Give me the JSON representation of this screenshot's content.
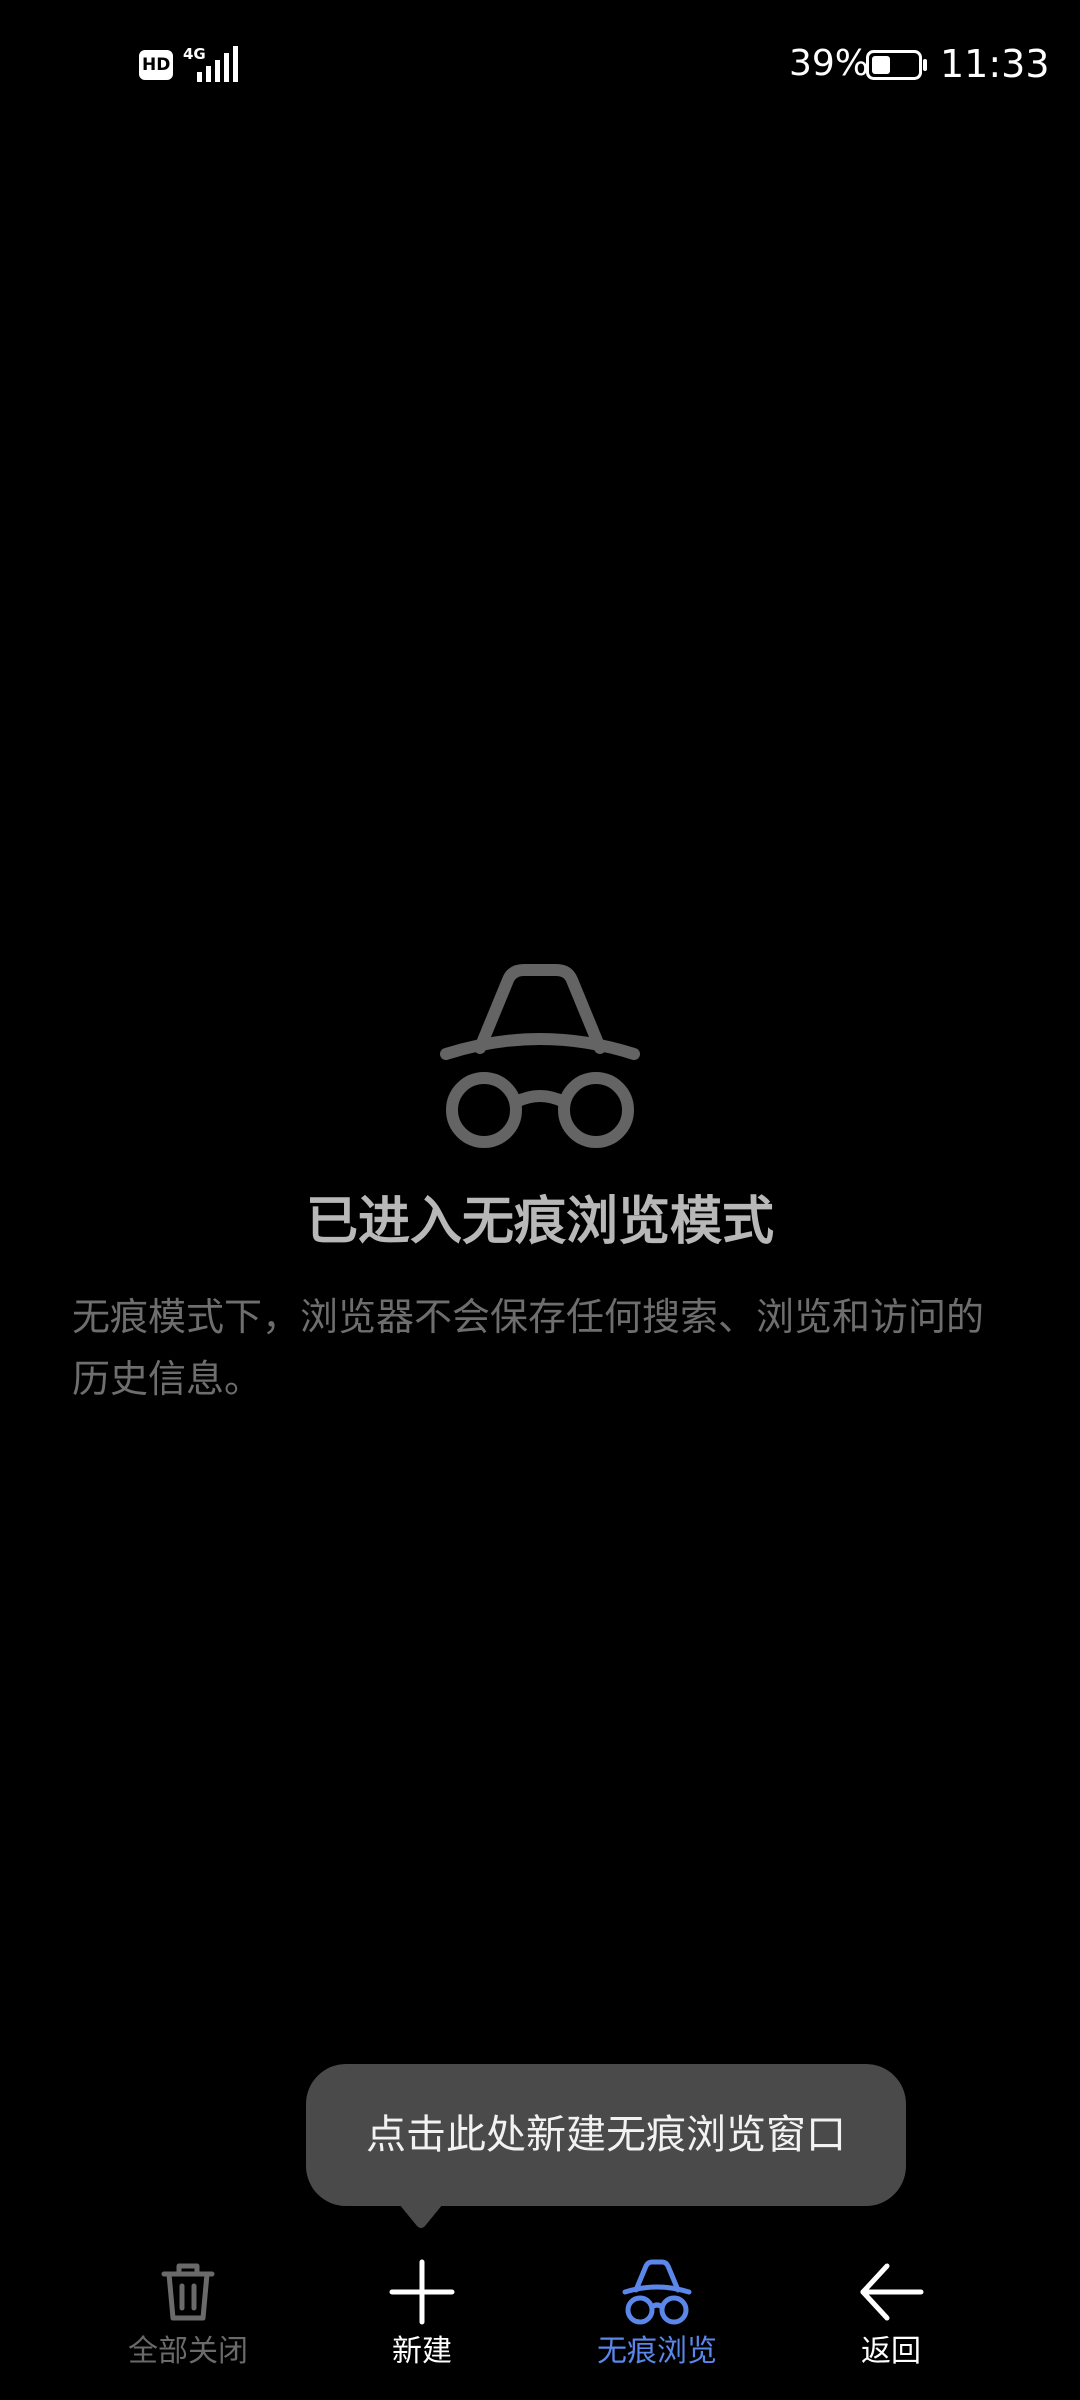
{
  "status_bar": {
    "hd_badge": "HD",
    "network_type": "4G",
    "battery_percent": "39%",
    "battery_level": 0.39,
    "time": "11:33",
    "icons": [
      "hd-icon",
      "signal-icon",
      "battery-icon"
    ]
  },
  "hero": {
    "icon": "incognito-icon",
    "title": "已进入无痕浏览模式",
    "description": "无痕模式下，浏览器不会保存任何搜索、浏览和访问的历史信息。"
  },
  "tooltip": {
    "text": "点击此处新建无痕浏览窗口"
  },
  "bottom_bar": {
    "items": [
      {
        "label": "全部关闭",
        "icon": "trash-icon",
        "state": "disabled"
      },
      {
        "label": "新建",
        "icon": "plus-icon",
        "state": "normal"
      },
      {
        "label": "无痕浏览",
        "icon": "incognito-icon",
        "state": "active"
      },
      {
        "label": "返回",
        "icon": "back-arrow-icon",
        "state": "normal"
      }
    ]
  },
  "colors": {
    "background": "#000000",
    "title_text": "#b8b8b8",
    "description_text": "#6e6e6e",
    "tooltip_bg": "#4a4a4a",
    "active_accent": "#5b86ea",
    "disabled": "#6a6a6a"
  }
}
